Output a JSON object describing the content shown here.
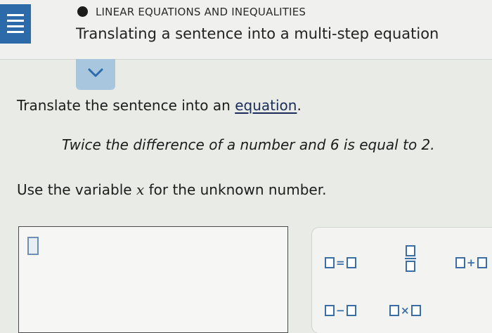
{
  "header": {
    "topic": "LINEAR EQUATIONS AND INEQUALITIES",
    "lesson_title": "Translating a sentence into a multi-step equation"
  },
  "problem": {
    "instruction_prefix": "Translate the sentence into an ",
    "instruction_link": "equation",
    "instruction_suffix": ".",
    "sentence": "Twice the difference of a number and 6 is equal to 2.",
    "variable_prefix": "Use the variable ",
    "variable_name": "x",
    "variable_suffix": " for the unknown number."
  },
  "keypad": {
    "equals_op": "=",
    "plus_op": "+",
    "minus_op": "−",
    "times_op": "×"
  },
  "colors": {
    "menu_blue": "#2d6aa9",
    "collapse_tab": "#a8c7df",
    "keypad_accent": "#3b6ea5"
  },
  "icons": {
    "menu": "hamburger-icon",
    "collapse": "chevron-down-icon",
    "status": "filled-circle"
  }
}
